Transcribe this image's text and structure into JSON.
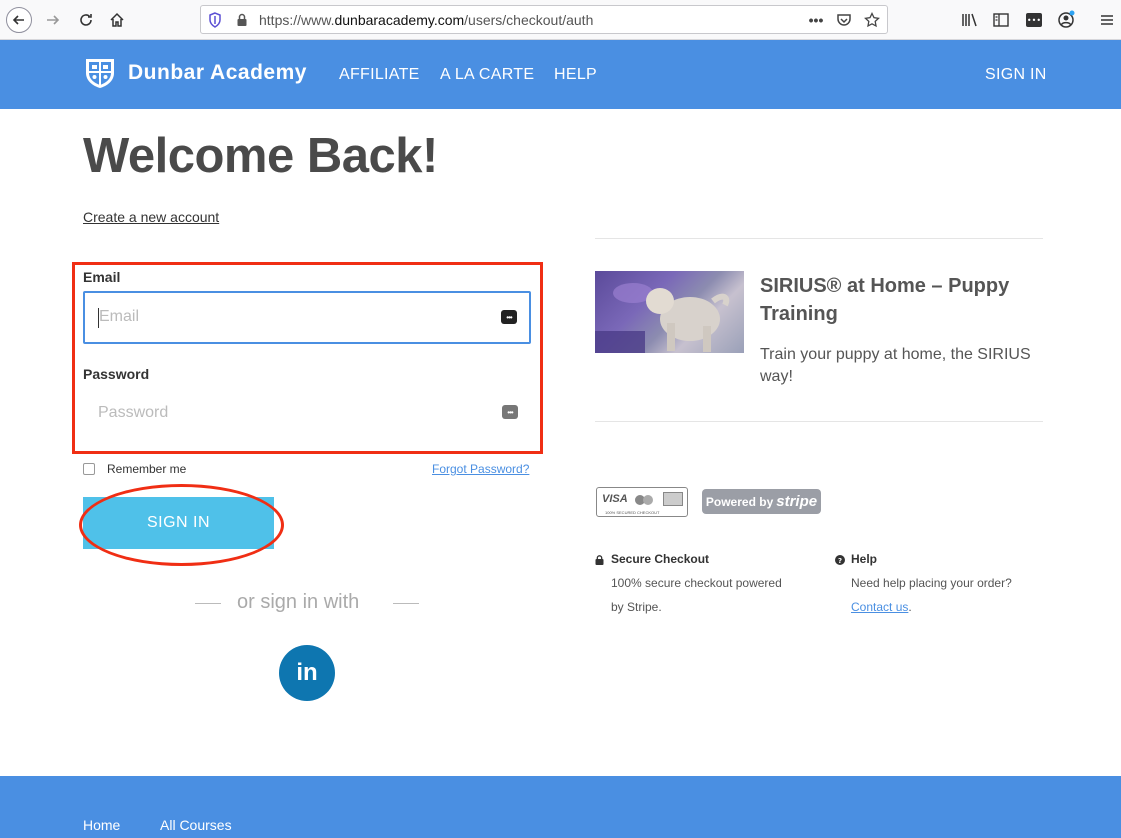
{
  "browser": {
    "url_prefix": "https://www.",
    "url_domain": "dunbaracademy.com",
    "url_path": "/users/checkout/auth"
  },
  "header": {
    "logo_text": "Dunbar Academy",
    "nav": [
      "AFFILIATE",
      "A LA CARTE",
      "HELP"
    ],
    "sign_in": "SIGN IN"
  },
  "main": {
    "title": "Welcome Back!",
    "create_account": "Create a new account",
    "email_label": "Email",
    "email_placeholder": "Email",
    "password_label": "Password",
    "password_placeholder": "Password",
    "remember_me": "Remember me",
    "forgot_password": "Forgot Password?",
    "sign_in_button": "SIGN IN",
    "or_sign_in_with": "or sign in with",
    "linkedin": "in"
  },
  "course": {
    "title": "SIRIUS® at Home – Puppy Training",
    "description": "Train your puppy at home, the SIRIUS way!"
  },
  "payment": {
    "cards_text": "VISA",
    "cards_subtext": "100% SECURED CHECKOUT",
    "powered_by": "Powered by",
    "stripe": "stripe"
  },
  "info": {
    "secure_title": "Secure Checkout",
    "secure_line1": "100% secure checkout powered",
    "secure_line2": "by Stripe.",
    "help_title": "Help",
    "help_line1": "Need help placing your order?",
    "help_link": "Contact us",
    "help_after": "."
  },
  "footer": {
    "links": [
      "Home",
      "All Courses"
    ]
  },
  "colors": {
    "brand_blue": "#4a8fe2",
    "button_cyan": "#4fc1e9",
    "annotation_red": "#f02e14",
    "linkedin_blue": "#0e76b0"
  }
}
